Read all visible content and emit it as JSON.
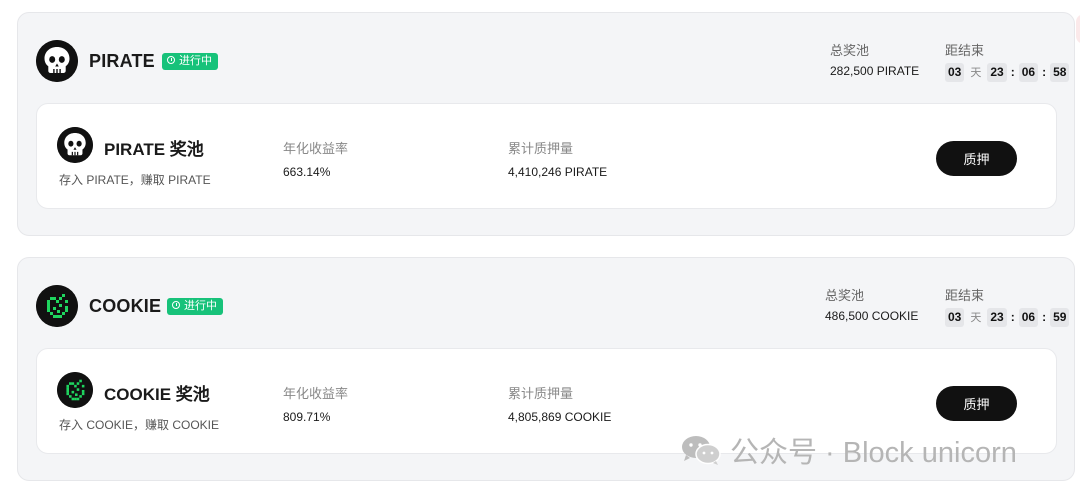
{
  "cards": [
    {
      "name": "PIRATE",
      "status": "进行中",
      "total_pool_label": "总奖池",
      "total_pool_value": "282,500 PIRATE",
      "end_label": "距结束",
      "countdown": {
        "days": "03",
        "days_unit": "天",
        "hours": "23",
        "minutes": "06",
        "seconds": "58"
      },
      "pool": {
        "title": "PIRATE 奖池",
        "subtitle": "存入 PIRATE，赚取 PIRATE",
        "apr_label": "年化收益率",
        "apr_value": "663.14%",
        "staked_label": "累计质押量",
        "staked_value": "4,410,246 PIRATE",
        "button_label": "质押"
      },
      "icon": "skull-icon"
    },
    {
      "name": "COOKIE",
      "status": "进行中",
      "total_pool_label": "总奖池",
      "total_pool_value": "486,500 COOKIE",
      "end_label": "距结束",
      "countdown": {
        "days": "03",
        "days_unit": "天",
        "hours": "23",
        "minutes": "06",
        "seconds": "59"
      },
      "pool": {
        "title": "COOKIE 奖池",
        "subtitle": "存入 COOKIE，赚取 COOKIE",
        "apr_label": "年化收益率",
        "apr_value": "809.71%",
        "staked_label": "累计质押量",
        "staked_value": "4,805,869 COOKIE",
        "button_label": "质押"
      },
      "icon": "cookie-icon"
    }
  ],
  "watermark": {
    "text": "公众号 · Block unicorn",
    "icon": "wechat-icon"
  },
  "colors": {
    "status_green": "#17c27a",
    "button_dark": "#111111",
    "cookie_green": "#1fd65f"
  }
}
